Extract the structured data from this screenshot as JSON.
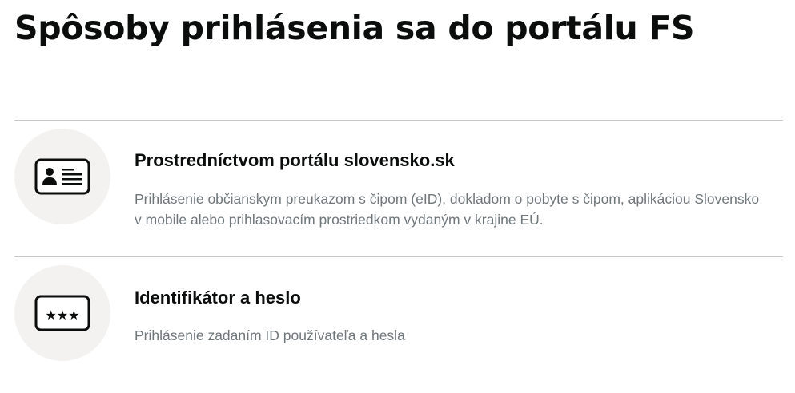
{
  "page": {
    "title": "Spôsoby prihlásenia sa do portálu FS"
  },
  "options": [
    {
      "title": "Prostredníctvom portálu slovensko.sk",
      "description_line1": "Prihlásenie občianskym preukazom s čipom (eID), dokladom o pobyte s čipom, aplikáciou Slovensko",
      "description_line2": "v mobile alebo prihlasovacím prostriedkom vydaným v krajine EÚ.",
      "icon": "id-card-icon"
    },
    {
      "title": "Identifikátor a heslo",
      "description_line1": "Prihlásenie zadaním ID používateľa a hesla",
      "icon": "password-field-icon"
    }
  ],
  "colors": {
    "title_text": "#0b0c0c",
    "description_text": "#6f777b",
    "icon_background": "#f3f2f1",
    "divider": "#c8c8c8"
  }
}
